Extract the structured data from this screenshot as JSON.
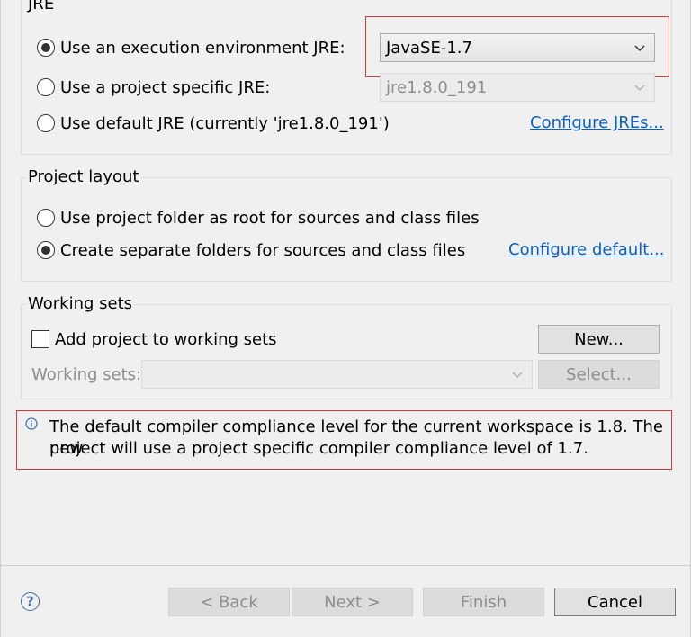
{
  "jre": {
    "title": "JRE",
    "option_env": "Use an execution environment JRE:",
    "option_project": "Use a project specific JRE:",
    "option_default": "Use default JRE (currently 'jre1.8.0_191')",
    "env_value": "JavaSE-1.7",
    "project_value": "jre1.8.0_191",
    "configure_link": "Configure JREs..."
  },
  "layout": {
    "title": "Project layout",
    "option_root": "Use project folder as root for sources and class files",
    "option_separate": "Create separate folders for sources and class files",
    "configure_link": "Configure default..."
  },
  "working_sets": {
    "title": "Working sets",
    "checkbox_label": "Add project to working sets",
    "new_button": "New...",
    "sets_label": "Working sets:",
    "sets_value": "",
    "select_button": "Select..."
  },
  "info": {
    "icon": "i",
    "message_line1": "The default compiler compliance level for the current workspace is 1.8. The new",
    "message_line2": "project will use a project specific compiler compliance level of 1.7."
  },
  "footer": {
    "help": "?",
    "back": "< Back",
    "next": "Next >",
    "finish": "Finish",
    "cancel": "Cancel"
  },
  "colors": {
    "link": "#0b62c4",
    "highlight_border": "#d23b3b",
    "info_icon": "#3b6ea8"
  }
}
